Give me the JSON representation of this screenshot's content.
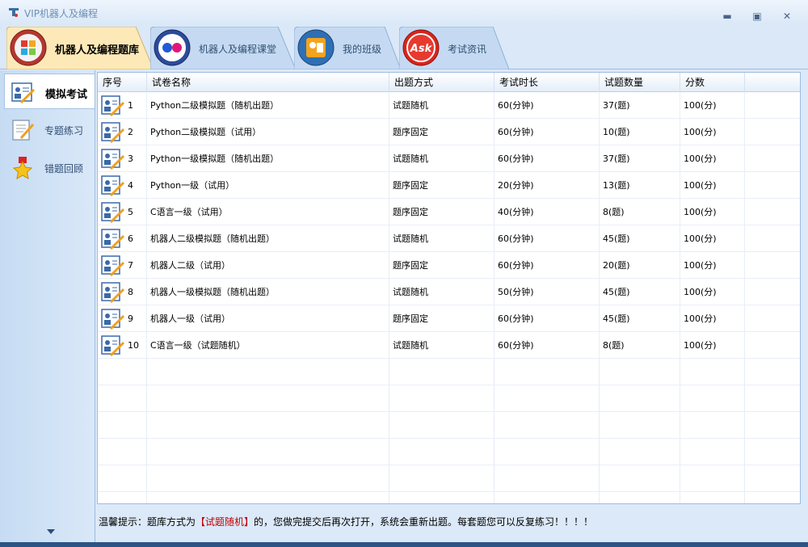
{
  "window": {
    "title": "VIP机器人及编程",
    "controls": {
      "minimize": "▬",
      "restore": "▣",
      "close": "✕"
    }
  },
  "tabs": [
    {
      "label": "机器人及编程题库",
      "icon": "puzzle-icon",
      "active": true
    },
    {
      "label": "机器人及编程课堂",
      "icon": "flickr-dots-icon",
      "active": false
    },
    {
      "label": "我的班级",
      "icon": "class-icon",
      "active": false
    },
    {
      "label": "考试资讯",
      "icon": "ask-icon",
      "active": false
    }
  ],
  "sidebar": {
    "items": [
      {
        "label": "模拟考试",
        "icon": "exam-icon",
        "active": true
      },
      {
        "label": "专题练习",
        "icon": "notepad-icon",
        "active": false
      },
      {
        "label": "错题回顾",
        "icon": "star-medal-icon",
        "active": false
      }
    ]
  },
  "table": {
    "columns": [
      "序号",
      "试卷名称",
      "出题方式",
      "考试时长",
      "试题数量",
      "分数"
    ],
    "rows": [
      {
        "no": "1",
        "name": "Python二级模拟题（随机出题）",
        "mode": "试题随机",
        "duration": "60(分钟)",
        "count": "37(题)",
        "score": "100(分)"
      },
      {
        "no": "2",
        "name": "Python二级模拟题（试用）",
        "mode": "题序固定",
        "duration": "60(分钟)",
        "count": "10(题)",
        "score": "100(分)"
      },
      {
        "no": "3",
        "name": "Python一级模拟题（随机出题）",
        "mode": "试题随机",
        "duration": "60(分钟)",
        "count": "37(题)",
        "score": "100(分)"
      },
      {
        "no": "4",
        "name": "Python一级（试用）",
        "mode": "题序固定",
        "duration": "20(分钟)",
        "count": "13(题)",
        "score": "100(分)"
      },
      {
        "no": "5",
        "name": "C语言一级（试用）",
        "mode": "题序固定",
        "duration": "40(分钟)",
        "count": "8(题)",
        "score": "100(分)"
      },
      {
        "no": "6",
        "name": "机器人二级模拟题（随机出题）",
        "mode": "试题随机",
        "duration": "60(分钟)",
        "count": "45(题)",
        "score": "100(分)"
      },
      {
        "no": "7",
        "name": "机器人二级（试用）",
        "mode": "题序固定",
        "duration": "60(分钟)",
        "count": "20(题)",
        "score": "100(分)"
      },
      {
        "no": "8",
        "name": "机器人一级模拟题（随机出题）",
        "mode": "试题随机",
        "duration": "50(分钟)",
        "count": "45(题)",
        "score": "100(分)"
      },
      {
        "no": "9",
        "name": "机器人一级（试用）",
        "mode": "题序固定",
        "duration": "60(分钟)",
        "count": "45(题)",
        "score": "100(分)"
      },
      {
        "no": "10",
        "name": "C语言一级（试题随机）",
        "mode": "试题随机",
        "duration": "60(分钟)",
        "count": "8(题)",
        "score": "100(分)"
      }
    ]
  },
  "tip": {
    "prefix": "温馨提示：题库方式为",
    "highlight": "【试题随机】",
    "suffix": "的，您做完提交后再次打开，系统会重新出题。每套题您可以反复练习！！！！"
  },
  "colors": {
    "accent": "#2c5485",
    "highlight": "#c00000"
  }
}
